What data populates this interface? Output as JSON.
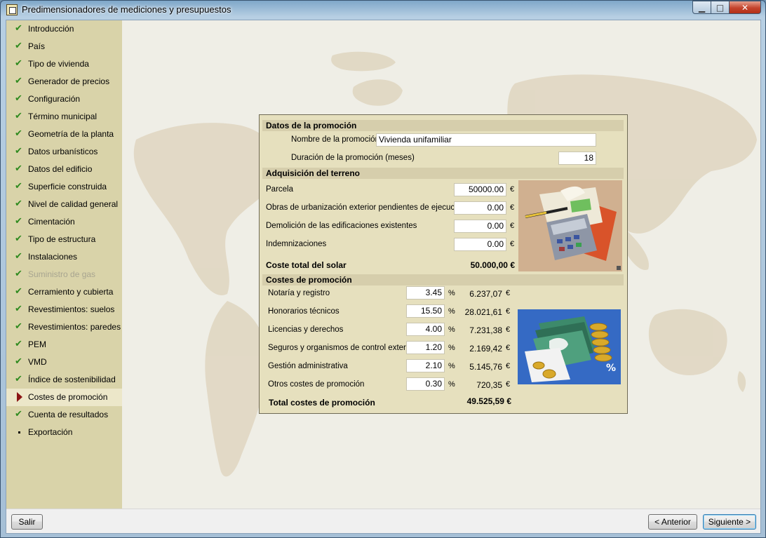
{
  "window": {
    "title": "Predimensionadores de mediciones y presupuestos",
    "minimize": "▁",
    "maximize": "□",
    "close": "✕"
  },
  "sidebar": {
    "items": [
      {
        "label": "Introducción",
        "state": "done"
      },
      {
        "label": "País",
        "state": "done"
      },
      {
        "label": "Tipo de vivienda",
        "state": "done"
      },
      {
        "label": "Generador de precios",
        "state": "done"
      },
      {
        "label": "Configuración",
        "state": "done"
      },
      {
        "label": "Término municipal",
        "state": "done"
      },
      {
        "label": "Geometría de la planta",
        "state": "done"
      },
      {
        "label": "Datos urbanísticos",
        "state": "done"
      },
      {
        "label": "Datos del edificio",
        "state": "done"
      },
      {
        "label": "Superficie construida",
        "state": "done"
      },
      {
        "label": "Nivel de calidad general",
        "state": "done"
      },
      {
        "label": "Cimentación",
        "state": "done"
      },
      {
        "label": "Tipo de estructura",
        "state": "done"
      },
      {
        "label": "Instalaciones",
        "state": "done"
      },
      {
        "label": "Suministro de gas",
        "state": "disabled"
      },
      {
        "label": "Cerramiento y cubierta",
        "state": "done"
      },
      {
        "label": "Revestimientos: suelos",
        "state": "done"
      },
      {
        "label": "Revestimientos: paredes",
        "state": "done"
      },
      {
        "label": "PEM",
        "state": "done"
      },
      {
        "label": "VMD",
        "state": "done"
      },
      {
        "label": "Índice de sostenibilidad",
        "state": "done"
      },
      {
        "label": "Costes de promoción",
        "state": "current"
      },
      {
        "label": "Cuenta de resultados",
        "state": "done"
      },
      {
        "label": "Exportación",
        "state": "pending"
      }
    ]
  },
  "promocion": {
    "section_title": "Datos de la promoción",
    "nombre_label": "Nombre de la promoción",
    "nombre_value": "Vivienda unifamiliar",
    "duracion_label": "Duración de la promoción (meses)",
    "duracion_value": "18"
  },
  "terreno": {
    "section_title": "Adquisición del terreno",
    "rows": [
      {
        "label": "Parcela",
        "value": "50000.00",
        "unit": "€"
      },
      {
        "label": "Obras de urbanización exterior pendientes de ejecución",
        "value": "0.00",
        "unit": "€"
      },
      {
        "label": "Demolición de las edificaciones existentes",
        "value": "0.00",
        "unit": "€"
      },
      {
        "label": "Indemnizaciones",
        "value": "0.00",
        "unit": "€"
      }
    ],
    "total_label": "Coste total del solar",
    "total_value": "50.000,00 €"
  },
  "costes": {
    "section_title": "Costes de promoción",
    "rows": [
      {
        "label": "Notaría y registro",
        "percent": "3.45",
        "pct_unit": "%",
        "amount": "6.237,07",
        "unit": "€"
      },
      {
        "label": "Honorarios técnicos",
        "percent": "15.50",
        "pct_unit": "%",
        "amount": "28.021,61",
        "unit": "€"
      },
      {
        "label": "Licencias y derechos",
        "percent": "4.00",
        "pct_unit": "%",
        "amount": "7.231,38",
        "unit": "€"
      },
      {
        "label": "Seguros y organismos de control externo",
        "percent": "1.20",
        "pct_unit": "%",
        "amount": "2.169,42",
        "unit": "€"
      },
      {
        "label": "Gestión administrativa",
        "percent": "2.10",
        "pct_unit": "%",
        "amount": "5.145,76",
        "unit": "€"
      },
      {
        "label": "Otros costes de promoción",
        "percent": "0.30",
        "pct_unit": "%",
        "amount": "720,35",
        "unit": "€"
      }
    ],
    "total_label": "Total costes de promoción",
    "total_value": "49.525,59 €"
  },
  "buttons": {
    "exit": "Salir",
    "previous": "< Anterior",
    "next": "Siguiente >"
  },
  "colors": {
    "sidebar_bg": "#d9d3a9",
    "panel_bg": "#e6e0be",
    "section_bg": "#d6ceac",
    "check": "#2e8a1e",
    "current_arrow": "#8b1414"
  }
}
